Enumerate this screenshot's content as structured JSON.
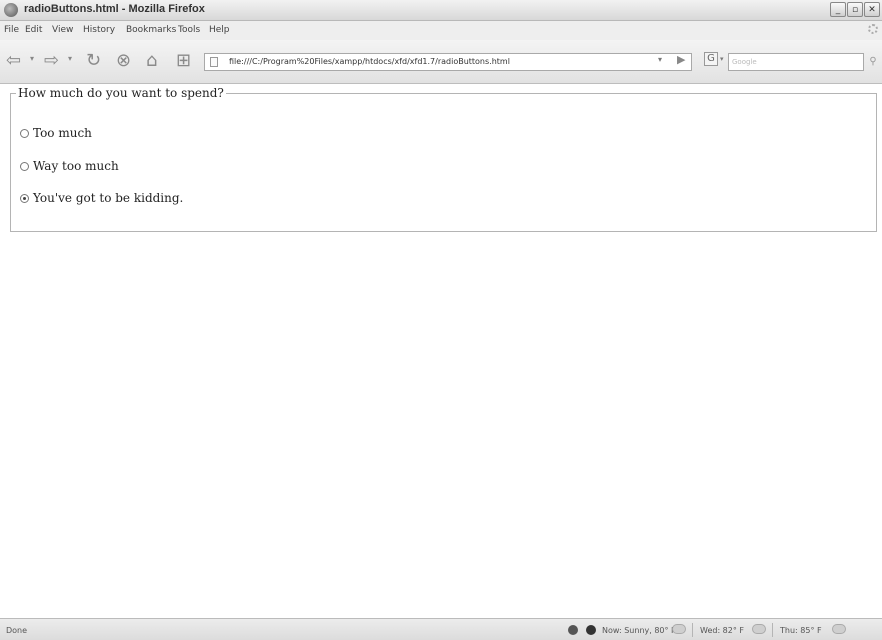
{
  "window": {
    "title": "radioButtons.html - Mozilla Firefox",
    "minimize": "_",
    "maximize": "▫",
    "close": "✕"
  },
  "menu": [
    "File",
    "Edit",
    "View",
    "History",
    "Bookmarks",
    "Tools",
    "Help"
  ],
  "navbar": {
    "url": "file:///C:/Program%20Files/xampp/htdocs/xfd/xfd1.7/radioButtons.html",
    "search_placeholder": "Google"
  },
  "form": {
    "legend": "How much do you want to spend?",
    "options": [
      {
        "label": "Too much",
        "checked": false
      },
      {
        "label": "Way too much",
        "checked": false
      },
      {
        "label": "You've got to be kidding.",
        "checked": true
      }
    ]
  },
  "status": {
    "text": "Done",
    "now": "Now: Sunny, 80° F",
    "wed": "Wed: 82° F",
    "thu": "Thu: 85° F"
  }
}
